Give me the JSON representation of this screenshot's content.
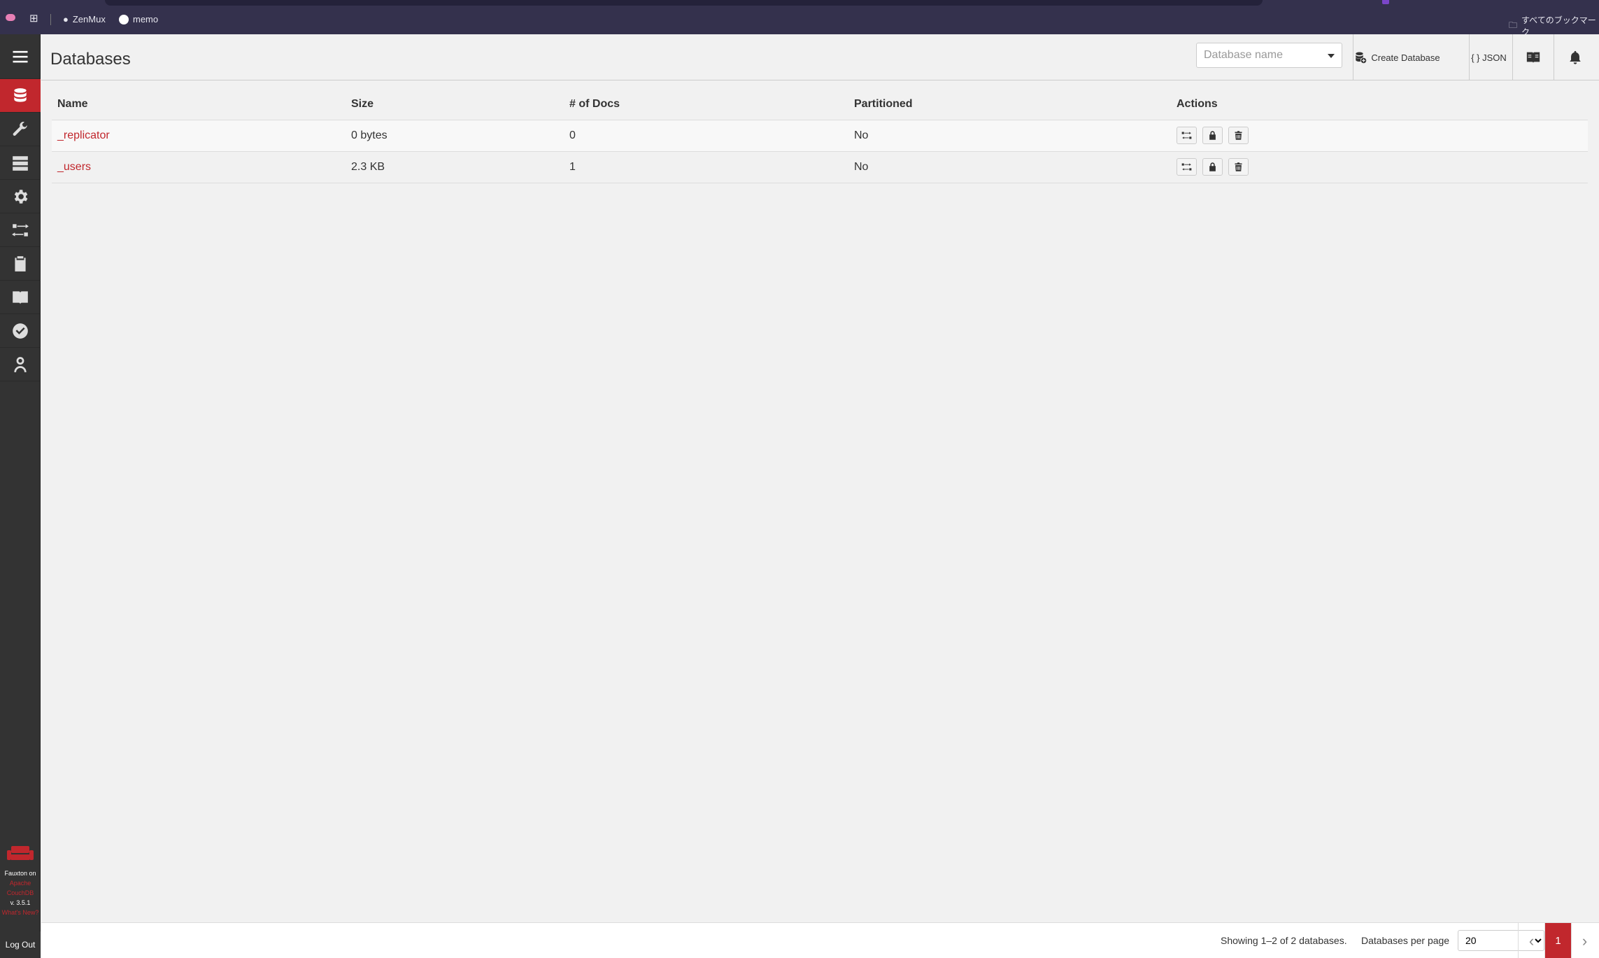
{
  "browser": {
    "bookmarks": [
      {
        "label": "ZenMux"
      },
      {
        "label": "memo"
      }
    ],
    "all_bookmarks": "すべてのブックマーク"
  },
  "sidebar": {
    "items": [
      {
        "name": "databases",
        "icon": "database-icon",
        "active": true
      },
      {
        "name": "setup",
        "icon": "wrench-icon"
      },
      {
        "name": "active-tasks",
        "icon": "tasks-icon"
      },
      {
        "name": "config",
        "icon": "gear-icon"
      },
      {
        "name": "replication",
        "icon": "replication-icon"
      },
      {
        "name": "documentation",
        "icon": "clipboard-icon"
      },
      {
        "name": "docs",
        "icon": "book-icon"
      },
      {
        "name": "verify",
        "icon": "check-circle-icon"
      },
      {
        "name": "user",
        "icon": "user-icon"
      }
    ],
    "footer": {
      "line1": "Fauxton on",
      "line2": "Apache",
      "line3": "CouchDB",
      "version": "v. 3.5.1",
      "whats_new": "What's New?"
    },
    "logout": "Log Out"
  },
  "header": {
    "title": "Databases",
    "search_placeholder": "Database name",
    "create_label": "Create Database",
    "json_label": "{ } JSON"
  },
  "table": {
    "columns": [
      "Name",
      "Size",
      "# of Docs",
      "Partitioned",
      "Actions"
    ],
    "rows": [
      {
        "name": "_replicator",
        "size": "0 bytes",
        "docs": "0",
        "partitioned": "No"
      },
      {
        "name": "_users",
        "size": "2.3 KB",
        "docs": "1",
        "partitioned": "No"
      }
    ]
  },
  "footer": {
    "showing": "Showing 1–2 of 2 databases.",
    "per_page_label": "Databases per page",
    "per_page_value": "20",
    "current_page": "1"
  },
  "colors": {
    "accent": "#c1272d",
    "sidebar": "#333333",
    "browser": "#34314d"
  }
}
